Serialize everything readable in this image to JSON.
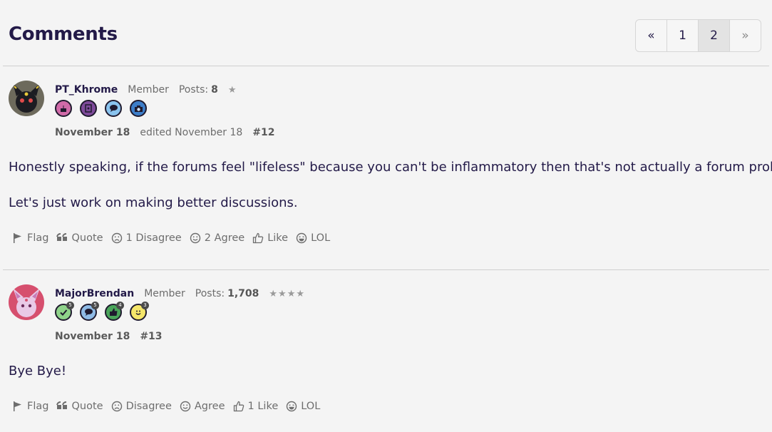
{
  "header": {
    "title": "Comments",
    "pagination": {
      "prev": "«",
      "pages": [
        "1",
        "2"
      ],
      "current": "2",
      "next": "»"
    }
  },
  "comments": [
    {
      "author": "PT_Khrome",
      "role": "Member",
      "posts_label": "Posts:",
      "posts_count": "8",
      "rank_stars": "★",
      "badges": [
        {
          "icon": "cake-icon",
          "color": "#d06aa8"
        },
        {
          "icon": "book-icon",
          "color": "#7e4a9a"
        },
        {
          "icon": "speech-bubble-icon",
          "color": "#89c3ee"
        },
        {
          "icon": "camera-icon",
          "color": "#3d7ec9"
        }
      ],
      "date": "November 18",
      "edited": "edited November 18",
      "number": "#12",
      "paragraphs": [
        "Honestly speaking, if the forums feel \"lifeless\" because you can't be inflammatory then that's not actually a forum problem.",
        "Let's just work on making better discussions."
      ],
      "reactions": {
        "flag": "Flag",
        "quote": "Quote",
        "disagree": "1 Disagree",
        "agree": "2 Agree",
        "like": "Like",
        "lol": "LOL"
      }
    },
    {
      "author": "MajorBrendan",
      "role": "Member",
      "posts_label": "Posts:",
      "posts_count": "1,708",
      "rank_stars": "★★★★",
      "badges": [
        {
          "icon": "checkmark-icon",
          "color": "#8fd38a",
          "count": "5"
        },
        {
          "icon": "speech-bubble-icon",
          "color": "#8fbbe6",
          "count": "5"
        },
        {
          "icon": "thumbs-up-icon",
          "color": "#4aa55a",
          "count": "4"
        },
        {
          "icon": "smile-icon",
          "color": "#f5e66a",
          "count": "3"
        }
      ],
      "date": "November 18",
      "number": "#13",
      "paragraphs": [
        "Bye Bye!"
      ],
      "reactions": {
        "flag": "Flag",
        "quote": "Quote",
        "disagree": "Disagree",
        "agree": "Agree",
        "like": "1 Like",
        "lol": "LOL"
      }
    }
  ]
}
